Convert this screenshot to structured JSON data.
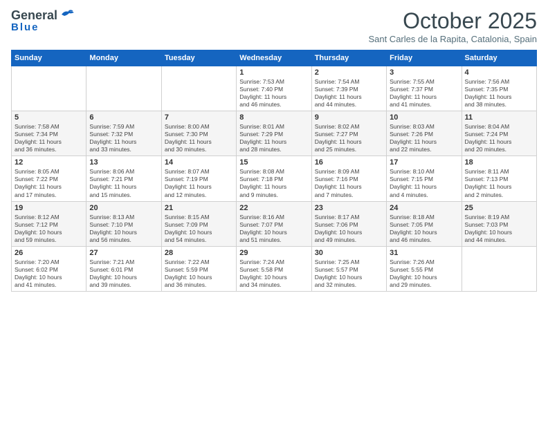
{
  "header": {
    "logo_general": "General",
    "logo_blue": "Blue",
    "month": "October 2025",
    "location": "Sant Carles de la Rapita, Catalonia, Spain"
  },
  "weekdays": [
    "Sunday",
    "Monday",
    "Tuesday",
    "Wednesday",
    "Thursday",
    "Friday",
    "Saturday"
  ],
  "weeks": [
    [
      {
        "day": "",
        "info": ""
      },
      {
        "day": "",
        "info": ""
      },
      {
        "day": "",
        "info": ""
      },
      {
        "day": "1",
        "info": "Sunrise: 7:53 AM\nSunset: 7:40 PM\nDaylight: 11 hours\nand 46 minutes."
      },
      {
        "day": "2",
        "info": "Sunrise: 7:54 AM\nSunset: 7:39 PM\nDaylight: 11 hours\nand 44 minutes."
      },
      {
        "day": "3",
        "info": "Sunrise: 7:55 AM\nSunset: 7:37 PM\nDaylight: 11 hours\nand 41 minutes."
      },
      {
        "day": "4",
        "info": "Sunrise: 7:56 AM\nSunset: 7:35 PM\nDaylight: 11 hours\nand 38 minutes."
      }
    ],
    [
      {
        "day": "5",
        "info": "Sunrise: 7:58 AM\nSunset: 7:34 PM\nDaylight: 11 hours\nand 36 minutes."
      },
      {
        "day": "6",
        "info": "Sunrise: 7:59 AM\nSunset: 7:32 PM\nDaylight: 11 hours\nand 33 minutes."
      },
      {
        "day": "7",
        "info": "Sunrise: 8:00 AM\nSunset: 7:30 PM\nDaylight: 11 hours\nand 30 minutes."
      },
      {
        "day": "8",
        "info": "Sunrise: 8:01 AM\nSunset: 7:29 PM\nDaylight: 11 hours\nand 28 minutes."
      },
      {
        "day": "9",
        "info": "Sunrise: 8:02 AM\nSunset: 7:27 PM\nDaylight: 11 hours\nand 25 minutes."
      },
      {
        "day": "10",
        "info": "Sunrise: 8:03 AM\nSunset: 7:26 PM\nDaylight: 11 hours\nand 22 minutes."
      },
      {
        "day": "11",
        "info": "Sunrise: 8:04 AM\nSunset: 7:24 PM\nDaylight: 11 hours\nand 20 minutes."
      }
    ],
    [
      {
        "day": "12",
        "info": "Sunrise: 8:05 AM\nSunset: 7:22 PM\nDaylight: 11 hours\nand 17 minutes."
      },
      {
        "day": "13",
        "info": "Sunrise: 8:06 AM\nSunset: 7:21 PM\nDaylight: 11 hours\nand 15 minutes."
      },
      {
        "day": "14",
        "info": "Sunrise: 8:07 AM\nSunset: 7:19 PM\nDaylight: 11 hours\nand 12 minutes."
      },
      {
        "day": "15",
        "info": "Sunrise: 8:08 AM\nSunset: 7:18 PM\nDaylight: 11 hours\nand 9 minutes."
      },
      {
        "day": "16",
        "info": "Sunrise: 8:09 AM\nSunset: 7:16 PM\nDaylight: 11 hours\nand 7 minutes."
      },
      {
        "day": "17",
        "info": "Sunrise: 8:10 AM\nSunset: 7:15 PM\nDaylight: 11 hours\nand 4 minutes."
      },
      {
        "day": "18",
        "info": "Sunrise: 8:11 AM\nSunset: 7:13 PM\nDaylight: 11 hours\nand 2 minutes."
      }
    ],
    [
      {
        "day": "19",
        "info": "Sunrise: 8:12 AM\nSunset: 7:12 PM\nDaylight: 10 hours\nand 59 minutes."
      },
      {
        "day": "20",
        "info": "Sunrise: 8:13 AM\nSunset: 7:10 PM\nDaylight: 10 hours\nand 56 minutes."
      },
      {
        "day": "21",
        "info": "Sunrise: 8:15 AM\nSunset: 7:09 PM\nDaylight: 10 hours\nand 54 minutes."
      },
      {
        "day": "22",
        "info": "Sunrise: 8:16 AM\nSunset: 7:07 PM\nDaylight: 10 hours\nand 51 minutes."
      },
      {
        "day": "23",
        "info": "Sunrise: 8:17 AM\nSunset: 7:06 PM\nDaylight: 10 hours\nand 49 minutes."
      },
      {
        "day": "24",
        "info": "Sunrise: 8:18 AM\nSunset: 7:05 PM\nDaylight: 10 hours\nand 46 minutes."
      },
      {
        "day": "25",
        "info": "Sunrise: 8:19 AM\nSunset: 7:03 PM\nDaylight: 10 hours\nand 44 minutes."
      }
    ],
    [
      {
        "day": "26",
        "info": "Sunrise: 7:20 AM\nSunset: 6:02 PM\nDaylight: 10 hours\nand 41 minutes."
      },
      {
        "day": "27",
        "info": "Sunrise: 7:21 AM\nSunset: 6:01 PM\nDaylight: 10 hours\nand 39 minutes."
      },
      {
        "day": "28",
        "info": "Sunrise: 7:22 AM\nSunset: 5:59 PM\nDaylight: 10 hours\nand 36 minutes."
      },
      {
        "day": "29",
        "info": "Sunrise: 7:24 AM\nSunset: 5:58 PM\nDaylight: 10 hours\nand 34 minutes."
      },
      {
        "day": "30",
        "info": "Sunrise: 7:25 AM\nSunset: 5:57 PM\nDaylight: 10 hours\nand 32 minutes."
      },
      {
        "day": "31",
        "info": "Sunrise: 7:26 AM\nSunset: 5:55 PM\nDaylight: 10 hours\nand 29 minutes."
      },
      {
        "day": "",
        "info": ""
      }
    ]
  ]
}
